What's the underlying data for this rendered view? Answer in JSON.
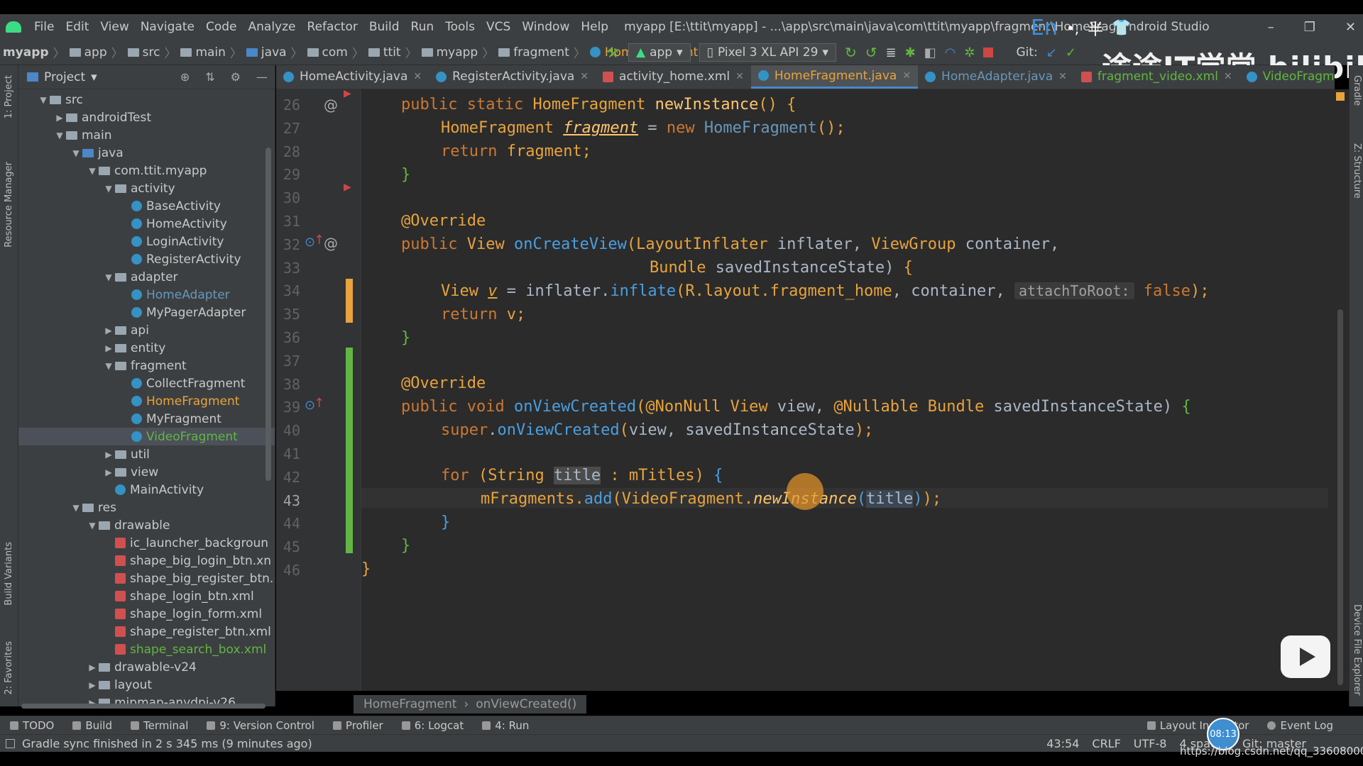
{
  "window": {
    "menu": [
      "File",
      "Edit",
      "View",
      "Navigate",
      "Code",
      "Analyze",
      "Refactor",
      "Build",
      "Run",
      "Tools",
      "VCS",
      "Window",
      "Help"
    ],
    "title": "myapp [E:\\ttit\\myapp] - ...\\app\\src\\main\\java\\com\\ttit\\myapp\\fragment\\HomeFragi",
    "title_suffix": "ndroid Studio",
    "ime": {
      "lang": "En",
      "punct": "•,",
      "width": "半"
    },
    "controls": {
      "minimize": "–",
      "restore": "❐",
      "close": "✕"
    }
  },
  "navbar": {
    "crumbs": [
      "myapp",
      "app",
      "src",
      "main",
      "java",
      "com",
      "ttit",
      "myapp",
      "fragment",
      "HomeFragment"
    ],
    "run_config": "app",
    "device": "Pixel 3 XL API 29",
    "git_label": "Git:"
  },
  "watermark": "途途IT学堂 bilibili",
  "project_panel": {
    "title": "Project",
    "tree": [
      {
        "label": "src",
        "depth": 0,
        "expanded": true,
        "kind": "folder"
      },
      {
        "label": "androidTest",
        "depth": 1,
        "expanded": false,
        "kind": "folder"
      },
      {
        "label": "main",
        "depth": 1,
        "expanded": true,
        "kind": "folder"
      },
      {
        "label": "java",
        "depth": 2,
        "expanded": true,
        "kind": "folder-blue"
      },
      {
        "label": "com.ttit.myapp",
        "depth": 3,
        "expanded": true,
        "kind": "package"
      },
      {
        "label": "activity",
        "depth": 4,
        "expanded": true,
        "kind": "package"
      },
      {
        "label": "BaseActivity",
        "depth": 5,
        "kind": "class"
      },
      {
        "label": "HomeActivity",
        "depth": 5,
        "kind": "class"
      },
      {
        "label": "LoginActivity",
        "depth": 5,
        "kind": "class"
      },
      {
        "label": "RegisterActivity",
        "depth": 5,
        "kind": "class"
      },
      {
        "label": "adapter",
        "depth": 4,
        "expanded": true,
        "kind": "package"
      },
      {
        "label": "HomeAdapter",
        "depth": 5,
        "kind": "class",
        "vcs": "modified"
      },
      {
        "label": "MyPagerAdapter",
        "depth": 5,
        "kind": "class"
      },
      {
        "label": "api",
        "depth": 4,
        "expanded": false,
        "kind": "package"
      },
      {
        "label": "entity",
        "depth": 4,
        "expanded": false,
        "kind": "package"
      },
      {
        "label": "fragment",
        "depth": 4,
        "expanded": true,
        "kind": "package"
      },
      {
        "label": "CollectFragment",
        "depth": 5,
        "kind": "class"
      },
      {
        "label": "HomeFragment",
        "depth": 5,
        "kind": "class",
        "vcs": "active"
      },
      {
        "label": "MyFragment",
        "depth": 5,
        "kind": "class"
      },
      {
        "label": "VideoFragment",
        "depth": 5,
        "kind": "class",
        "vcs": "new",
        "selected": true
      },
      {
        "label": "util",
        "depth": 4,
        "expanded": false,
        "kind": "package"
      },
      {
        "label": "view",
        "depth": 4,
        "expanded": false,
        "kind": "package"
      },
      {
        "label": "MainActivity",
        "depth": 4,
        "kind": "class"
      },
      {
        "label": "res",
        "depth": 2,
        "expanded": true,
        "kind": "folder"
      },
      {
        "label": "drawable",
        "depth": 3,
        "expanded": true,
        "kind": "folder"
      },
      {
        "label": "ic_launcher_backgroun",
        "depth": 4,
        "kind": "xml"
      },
      {
        "label": "shape_big_login_btn.xn",
        "depth": 4,
        "kind": "xml"
      },
      {
        "label": "shape_big_register_btn.",
        "depth": 4,
        "kind": "xml"
      },
      {
        "label": "shape_login_btn.xml",
        "depth": 4,
        "kind": "xml"
      },
      {
        "label": "shape_login_form.xml",
        "depth": 4,
        "kind": "xml"
      },
      {
        "label": "shape_register_btn.xml",
        "depth": 4,
        "kind": "xml"
      },
      {
        "label": "shape_search_box.xml",
        "depth": 4,
        "kind": "xml",
        "vcs": "new"
      },
      {
        "label": "drawable-v24",
        "depth": 3,
        "expanded": false,
        "kind": "folder"
      },
      {
        "label": "layout",
        "depth": 3,
        "expanded": false,
        "kind": "folder"
      },
      {
        "label": "mipmap-anydpi-v26",
        "depth": 3,
        "expanded": false,
        "kind": "folder"
      }
    ]
  },
  "left_strip": [
    "1: Project",
    "Resource Manager",
    "Build Variants",
    "2: Favorites"
  ],
  "right_strip": [
    "Gradle",
    "Z: Structure",
    "Device File Explorer"
  ],
  "tabs": [
    {
      "label": "HomeActivity.java",
      "kind": "class"
    },
    {
      "label": "RegisterActivity.java",
      "kind": "class"
    },
    {
      "label": "activity_home.xml",
      "kind": "xml"
    },
    {
      "label": "HomeFragment.java",
      "kind": "class",
      "active": true
    },
    {
      "label": "HomeAdapter.java",
      "kind": "class",
      "vcs": "modified"
    },
    {
      "label": "fragment_video.xml",
      "kind": "xml",
      "vcs": "new"
    },
    {
      "label": "VideoFragment.java",
      "kind": "class",
      "vcs": "new"
    }
  ],
  "editor": {
    "line_numbers": [
      "26",
      "27",
      "28",
      "29",
      "30",
      "31",
      "32",
      "33",
      "34",
      "35",
      "36",
      "37",
      "38",
      "39",
      "40",
      "41",
      "42",
      "43",
      "44",
      "45",
      "46"
    ],
    "current_line": "43",
    "hint": "attachToRoot:",
    "breadcrumb": [
      "HomeFragment",
      "onViewCreated()"
    ]
  },
  "bottom_tools": [
    "TODO",
    "Build",
    "Terminal",
    "9: Version Control",
    "Profiler",
    "6: Logcat",
    "4: Run"
  ],
  "bottom_tools_right": [
    "Layout Inspector",
    "Event Log"
  ],
  "status": {
    "message": "Gradle sync finished in 2 s 345 ms (9 minutes ago)",
    "position": "43:54",
    "line_sep": "CRLF",
    "encoding": "UTF-8",
    "indent": "4 spaces",
    "branch": "Git: master",
    "timer": "08:13",
    "url": "https://blog.csdn.net/qq_33608000"
  },
  "colors": {
    "accent": "#e8a33c",
    "vcs_new": "#62b543",
    "vcs_modified": "#6897bb",
    "keyword": "#cc7832",
    "function": "#ffc66d"
  }
}
